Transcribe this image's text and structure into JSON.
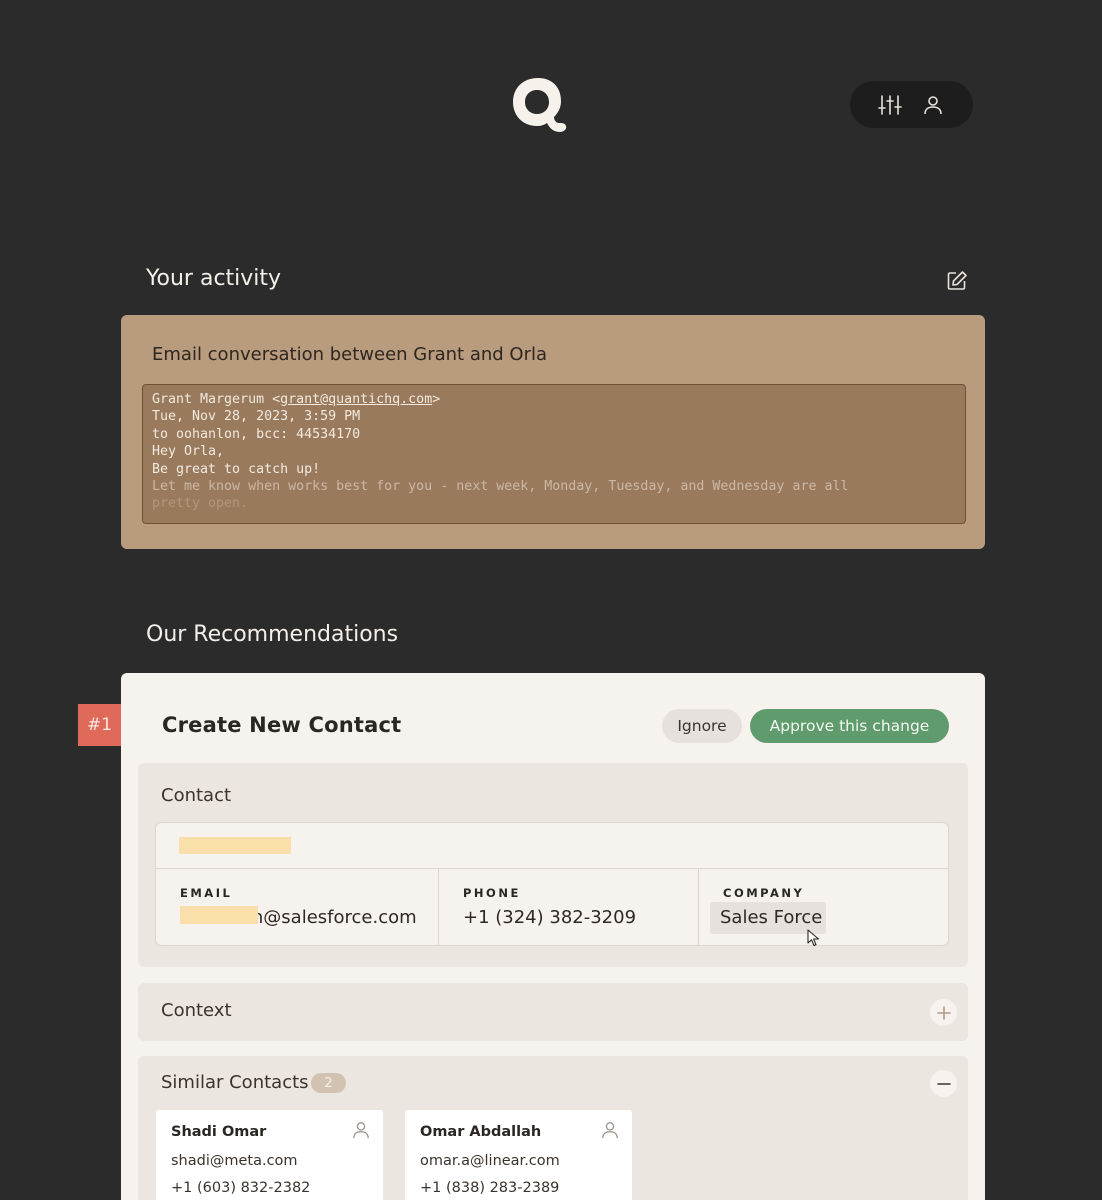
{
  "header": {
    "logo": "quantic-logo",
    "controls": [
      {
        "name": "filter-sliders-icon"
      },
      {
        "name": "user-icon"
      }
    ]
  },
  "activity": {
    "title": "Your activity",
    "card_heading": "Email conversation between Grant and Orla",
    "email": {
      "sender_name": "Grant Margerum <",
      "sender_email": "grant@quantichq.com",
      "sender_close": ">",
      "date": "Tue, Nov 28, 2023, 3:59 PM",
      "recipients": "to oohanlon, bcc: 44534170",
      "greeting": "Hey Orla,",
      "line1": "Be great to catch up!",
      "line2": "Let me know when works best for you - next week, Monday, Tuesday, and Wednesday are all",
      "line3": "pretty open."
    }
  },
  "recommendations": {
    "title": "Our Recommendations",
    "items": [
      {
        "rank": "#1",
        "heading": "Create New Contact",
        "ignore_label": "Ignore",
        "approve_label": "Approve this change",
        "contact": {
          "label": "Contact",
          "fields": {
            "email_label": "EMAIL",
            "email_value": "oohanlon@salesforce.com",
            "phone_label": "PHONE",
            "phone_value": "+1 (324) 382-3209",
            "company_label": "COMPANY",
            "company_value": "Sales Force"
          }
        },
        "context": {
          "label": "Context"
        },
        "similar": {
          "label": "Similar Contacts",
          "count": "2",
          "contacts": [
            {
              "name": "Shadi Omar",
              "email": "shadi@meta.com",
              "phone": "+1 (603) 832-2382"
            },
            {
              "name": "Omar Abdallah",
              "email": "omar.a@linear.com",
              "phone": "+1 (838) 283-2389"
            }
          ]
        }
      }
    ]
  },
  "colors": {
    "background": "#2b2b2b",
    "activity_card": "#b89c7d",
    "rank_badge": "#df6a5a",
    "approve": "#5f9b6c",
    "redaction": "#f9e0aa"
  }
}
